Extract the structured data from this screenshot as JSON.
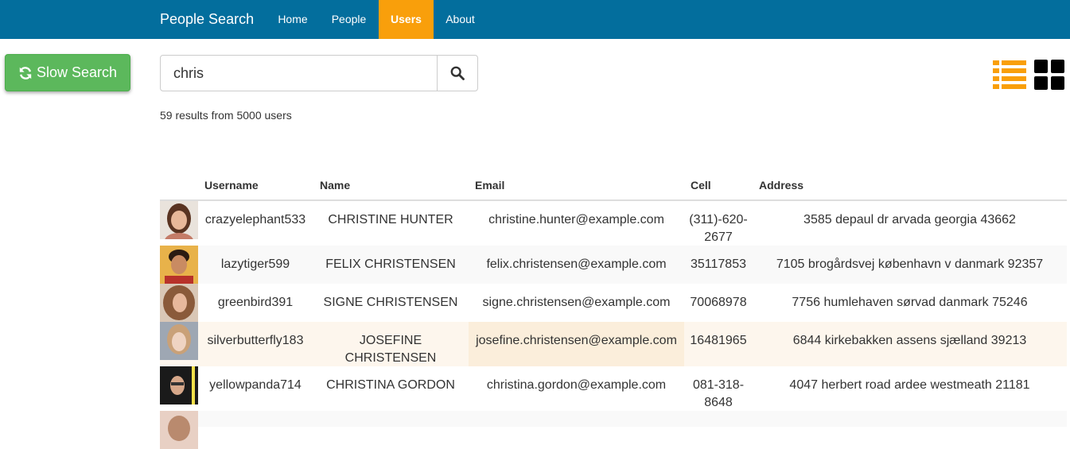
{
  "nav": {
    "brand": "People Search",
    "items": [
      {
        "label": "Home"
      },
      {
        "label": "People"
      },
      {
        "label": "Users"
      },
      {
        "label": "About"
      }
    ]
  },
  "slow_search": {
    "label": "Slow Search",
    "icon": "refresh-icon"
  },
  "search": {
    "value": "chris",
    "icon": "search-icon"
  },
  "results": {
    "summary": "59 results from 5000 users"
  },
  "view_toggle": {
    "list_icon": "list-view-icon",
    "grid_icon": "grid-view-icon",
    "list_color": "#f99f0b",
    "grid_color": "#000000"
  },
  "table": {
    "headers": {
      "username": "Username",
      "name": "Name",
      "email": "Email",
      "cell": "Cell",
      "address": "Address"
    },
    "rows": [
      {
        "username": "crazyelephant533",
        "name": "CHRISTINE HUNTER",
        "email": "christine.hunter@example.com",
        "cell": "(311)-620-2677",
        "address": "3585 depaul dr arvada georgia 43662"
      },
      {
        "username": "lazytiger599",
        "name": "FELIX CHRISTENSEN",
        "email": "felix.christensen@example.com",
        "cell": "35117853",
        "address": "7105 brogårdsvej københavn v danmark 92357"
      },
      {
        "username": "greenbird391",
        "name": "SIGNE CHRISTENSEN",
        "email": "signe.christensen@example.com",
        "cell": "70068978",
        "address": "7756 humlehaven sørvad danmark 75246"
      },
      {
        "username": "silverbutterfly183",
        "name": "JOSEFINE CHRISTENSEN",
        "email": "josefine.christensen@example.com",
        "cell": "16481965",
        "address": "6844 kirkebakken assens sjælland 39213"
      },
      {
        "username": "yellowpanda714",
        "name": "CHRISTINA GORDON",
        "email": "christina.gordon@example.com",
        "cell": "081-318-8648",
        "address": "4047 herbert road ardee westmeath 21181"
      }
    ]
  },
  "colors": {
    "navbar": "#036e9d",
    "nav_active": "#f99f0b",
    "slow_button": "#5cb85c"
  }
}
